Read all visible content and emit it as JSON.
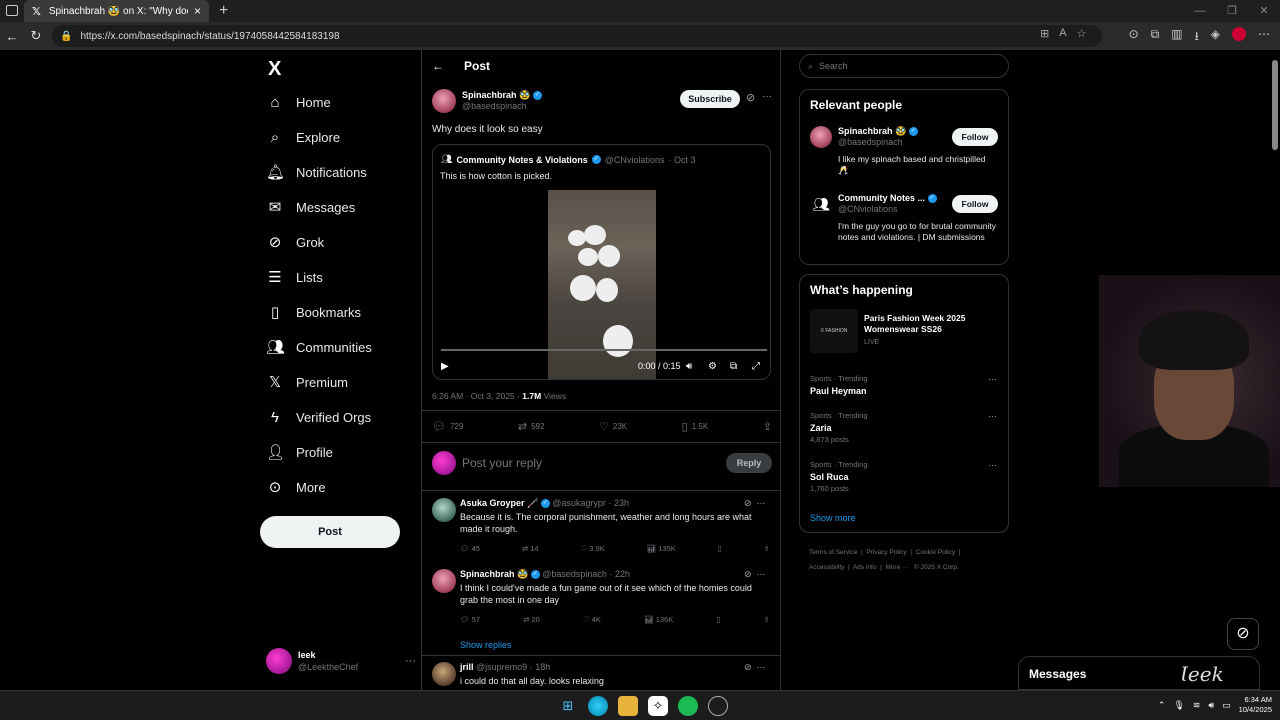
{
  "browser": {
    "tab_title": "Spinachbrah 🥸 on X: \"Why doe",
    "url": "https://x.com/basedspinach/status/1974058442584183198"
  },
  "sidebar": {
    "logo": "X",
    "items": [
      {
        "label": "Home",
        "icon": "home-icon"
      },
      {
        "label": "Explore",
        "icon": "search-icon"
      },
      {
        "label": "Notifications",
        "icon": "bell-icon"
      },
      {
        "label": "Messages",
        "icon": "mail-icon"
      },
      {
        "label": "Grok",
        "icon": "grok-icon"
      },
      {
        "label": "Lists",
        "icon": "list-icon"
      },
      {
        "label": "Bookmarks",
        "icon": "bookmark-icon"
      },
      {
        "label": "Communities",
        "icon": "people-icon"
      },
      {
        "label": "Premium",
        "icon": "x-icon"
      },
      {
        "label": "Verified Orgs",
        "icon": "lightning-icon"
      },
      {
        "label": "Profile",
        "icon": "person-icon"
      },
      {
        "label": "More",
        "icon": "more-circle-icon"
      }
    ],
    "post_label": "Post",
    "account": {
      "name": "Ɩeek",
      "handle": "@LeektheChef"
    }
  },
  "header": {
    "title": "Post"
  },
  "post": {
    "author_name": "Spinachbrah 🥸",
    "author_handle": "@basedspinach",
    "subscribe_label": "Subscribe",
    "text": "Why does it look so easy",
    "quote": {
      "author_name": "Community Notes & Violations",
      "author_handle": "@CNviolations",
      "date": "· Oct 3",
      "text": "This is how cotton is picked.",
      "video_time": "0:00 / 0:15"
    },
    "time": "6:26 AM · Oct 3, 2025 ·",
    "views": "1.7M",
    "views_label": "Views",
    "stats": {
      "replies": "729",
      "reposts": "592",
      "likes": "23K",
      "bookmarks": "1.5K"
    }
  },
  "reply_box": {
    "placeholder": "Post your reply",
    "button": "Reply"
  },
  "replies": [
    {
      "name": "Asuka Groyper 🦯",
      "handle": "@asukagrypr",
      "time": "· 23h",
      "text": "Because it is. The corporal punishment, weather and long hours are what made it rough.",
      "replies": "45",
      "reposts": "14",
      "likes": "3.9K",
      "views": "135K"
    },
    {
      "name": "Spinachbrah 🥸",
      "handle": "@basedspinach",
      "time": "· 22h",
      "text": "I think I could've made a fun game out of it see which of the homies could grab the most in one day",
      "replies": "57",
      "reposts": "20",
      "likes": "4K",
      "views": "136K"
    },
    {
      "name": "jrill",
      "handle": "@jsupremo9",
      "time": "· 18h",
      "text": "i could do that all day. looks relaxing",
      "replies": "",
      "reposts": "",
      "likes": "",
      "views": ""
    }
  ],
  "show_replies": "Show replies",
  "search": {
    "placeholder": "Search"
  },
  "relevant": {
    "title": "Relevant people",
    "people": [
      {
        "name": "Spinachbrah 🥸",
        "handle": "@basedspinach",
        "bio": "I like my spinach based and christpilled 🥂",
        "follow": "Follow"
      },
      {
        "name": "Community Notes ...",
        "handle": "@CNviolations",
        "bio": "I'm the guy you go to for brutal community notes and violations. | DM submissions",
        "follow": "Follow"
      }
    ]
  },
  "happening": {
    "title": "What’s happening",
    "featured": {
      "title": "Paris Fashion Week 2025 Womenswear SS26",
      "status": "LIVE",
      "thumb": "X FASHION"
    },
    "trends": [
      {
        "context": "Sports · Trending",
        "name": "Paul Heyman",
        "count": ""
      },
      {
        "context": "Sports · Trending",
        "name": "Zaria",
        "count": "4,873 posts"
      },
      {
        "context": "Sports · Trending",
        "name": "Sol Ruca",
        "count": "1,760 posts"
      }
    ],
    "show_more": "Show more"
  },
  "footer": {
    "links": [
      "Terms of Service",
      "Privacy Policy",
      "Cookie Policy",
      "Accessibility",
      "Ads info",
      "More ···",
      "© 2025 X Corp."
    ]
  },
  "messages_drawer": "Messages",
  "watermark": "Ɩeek",
  "taskbar": {
    "time": "6:34 AM",
    "date": "10/4/2025"
  }
}
